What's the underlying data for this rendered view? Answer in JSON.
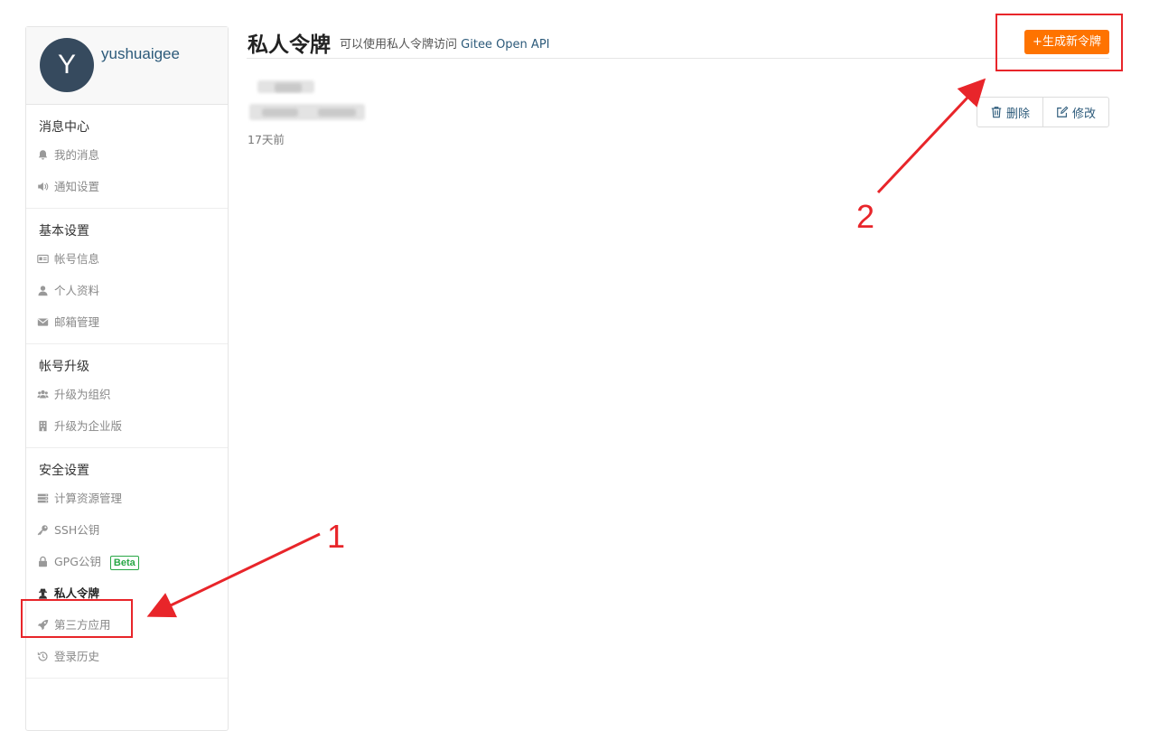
{
  "profile": {
    "avatar_letter": "Y",
    "username": "yushuaigee"
  },
  "sidebar": {
    "sections": [
      {
        "title": "消息中心",
        "items": [
          {
            "label": "我的消息",
            "icon": "bell-icon"
          },
          {
            "label": "通知设置",
            "icon": "volume-icon"
          }
        ]
      },
      {
        "title": "基本设置",
        "items": [
          {
            "label": "帐号信息",
            "icon": "id-card-icon"
          },
          {
            "label": "个人资料",
            "icon": "user-icon"
          },
          {
            "label": "邮箱管理",
            "icon": "envelope-icon"
          }
        ]
      },
      {
        "title": "帐号升级",
        "items": [
          {
            "label": "升级为组织",
            "icon": "users-icon"
          },
          {
            "label": "升级为企业版",
            "icon": "building-icon"
          }
        ]
      },
      {
        "title": "安全设置",
        "items": [
          {
            "label": "计算资源管理",
            "icon": "server-icon"
          },
          {
            "label": "SSH公钥",
            "icon": "key-icon"
          },
          {
            "label": "GPG公钥",
            "icon": "lock-icon",
            "badge": "Beta"
          },
          {
            "label": "私人令牌",
            "icon": "user-secret-icon",
            "active": true
          },
          {
            "label": "第三方应用",
            "icon": "rocket-icon"
          },
          {
            "label": "登录历史",
            "icon": "history-icon"
          }
        ]
      }
    ]
  },
  "main": {
    "title": "私人令牌",
    "subtitle_text": "可以使用私人令牌访问",
    "subtitle_link": "Gitee Open API",
    "new_token_button": "+生成新令牌",
    "token": {
      "created": "17天前",
      "delete_label": "删除",
      "edit_label": "修改"
    }
  },
  "annotations": {
    "step1": "1",
    "step2": "2",
    "color": "#e8252a"
  },
  "colors": {
    "accent": "#fe7300",
    "link": "#2c5a7a",
    "avatar_bg": "#364a5e",
    "beta_green": "#28a745"
  }
}
